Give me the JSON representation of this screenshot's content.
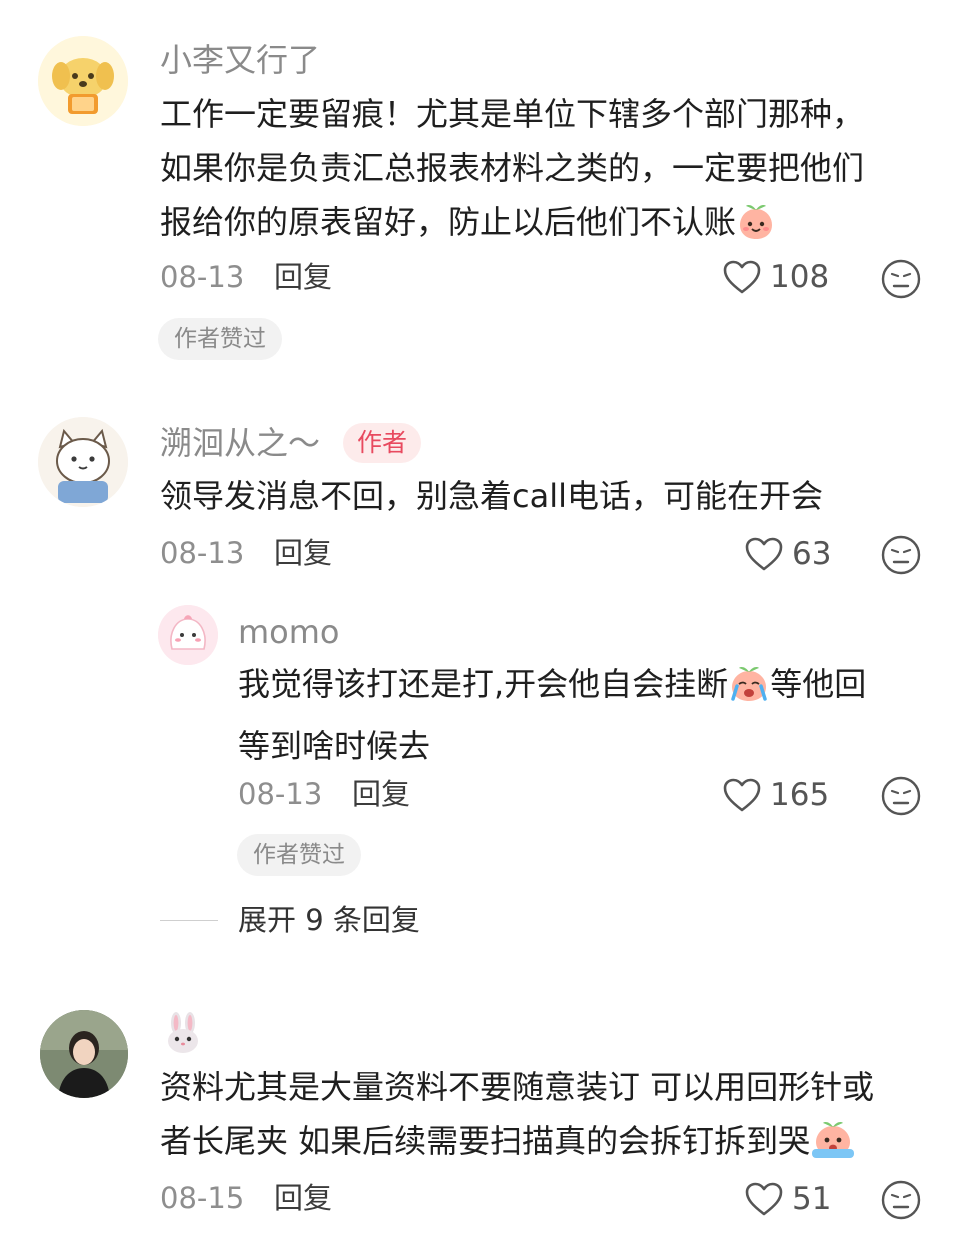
{
  "comments": [
    {
      "username": "小李又行了",
      "lines": [
        "工作一定要留痕！尤其是单位下辖多个部门那种，",
        "如果你是负责汇总报表材料之类的，一定要把他们",
        "报给你的原表留好，防止以后他们不认账"
      ],
      "date": "08-13",
      "reply_label": "回复",
      "likes": "108",
      "badge": "作者赞过"
    },
    {
      "username": "溯洄从之～",
      "author_tag": "作者",
      "lines": [
        "领导发消息不回，别急着call电话，可能在开会"
      ],
      "date": "08-13",
      "reply_label": "回复",
      "likes": "63"
    },
    {
      "username": "momo",
      "lines": [
        "我觉得该打还是打,开会他自会挂断",
        "等他回",
        "等到啥时候去"
      ],
      "date": "08-13",
      "reply_label": "回复",
      "likes": "165",
      "badge": "作者赞过"
    },
    {
      "lines": [
        "资料尤其是大量资料不要随意装订 可以用回形针或",
        "者长尾夹  如果后续需要扫描真的会拆钉拆到哭"
      ],
      "date": "08-15",
      "reply_label": "回复",
      "likes": "51"
    }
  ],
  "expand_replies": "展开 9 条回复",
  "colors": {
    "author_tag_bg": "#fdebeb",
    "author_tag_text": "#e84a5f",
    "badge_bg": "#f2f2f2"
  },
  "icons": [
    "heart-icon",
    "dislike-face-icon",
    "peach-emoji",
    "crying-peach-emoji",
    "rabbit-emoji"
  ]
}
